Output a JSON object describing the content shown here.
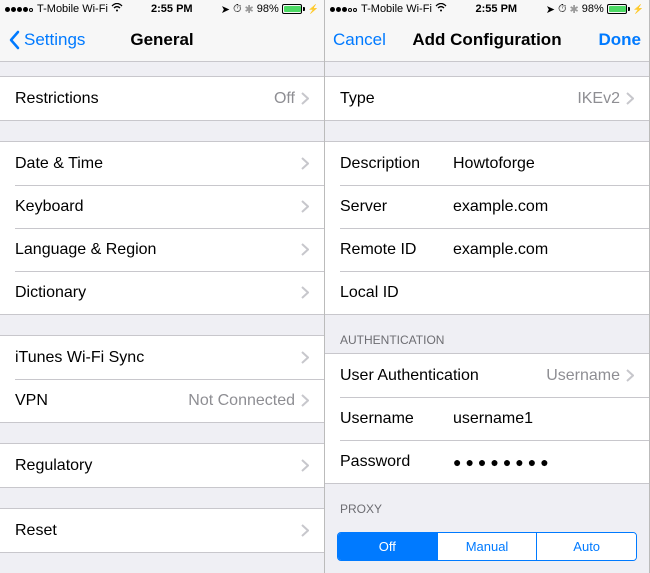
{
  "left": {
    "statusbar": {
      "carrier": "T-Mobile Wi-Fi",
      "time": "2:55 PM",
      "battery": "98%"
    },
    "nav": {
      "back": "Settings",
      "title": "General"
    },
    "groups": {
      "g1": {
        "restrictions": {
          "label": "Restrictions",
          "value": "Off"
        }
      },
      "g2": {
        "datetime": {
          "label": "Date & Time"
        },
        "keyboard": {
          "label": "Keyboard"
        },
        "language": {
          "label": "Language & Region"
        },
        "dictionary": {
          "label": "Dictionary"
        }
      },
      "g3": {
        "itunes": {
          "label": "iTunes Wi-Fi Sync"
        },
        "vpn": {
          "label": "VPN",
          "value": "Not Connected"
        }
      },
      "g4": {
        "regulatory": {
          "label": "Regulatory"
        }
      },
      "g5": {
        "reset": {
          "label": "Reset"
        }
      }
    }
  },
  "right": {
    "statusbar": {
      "carrier": "T-Mobile Wi-Fi",
      "time": "2:55 PM",
      "battery": "98%"
    },
    "nav": {
      "cancel": "Cancel",
      "title": "Add Configuration",
      "done": "Done"
    },
    "type": {
      "label": "Type",
      "value": "IKEv2"
    },
    "fields": {
      "description": {
        "label": "Description",
        "value": "Howtoforge"
      },
      "server": {
        "label": "Server",
        "value": "example.com"
      },
      "remoteid": {
        "label": "Remote ID",
        "value": "example.com"
      },
      "localid": {
        "label": "Local ID",
        "value": ""
      }
    },
    "auth_header": "Authentication",
    "auth": {
      "userauth": {
        "label": "User Authentication",
        "value": "Username"
      },
      "username": {
        "label": "Username",
        "value": "username1"
      },
      "password": {
        "label": "Password",
        "value": "●●●●●●●●"
      }
    },
    "proxy_header": "Proxy",
    "proxy": {
      "off": "Off",
      "manual": "Manual",
      "auto": "Auto"
    }
  }
}
